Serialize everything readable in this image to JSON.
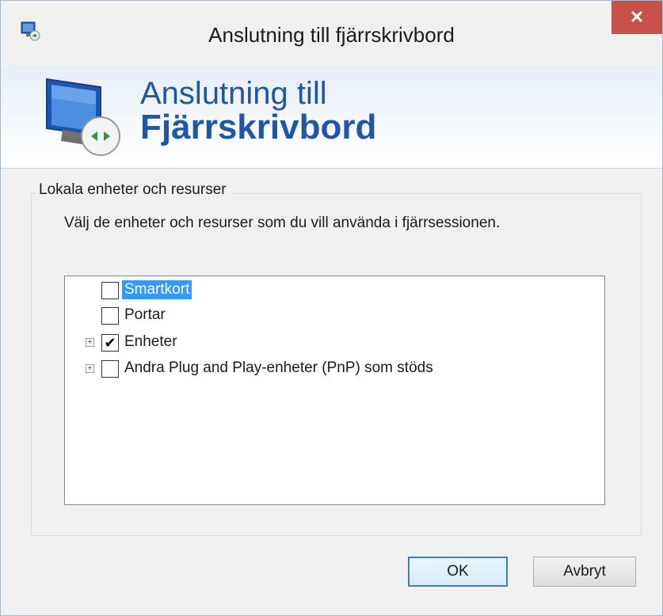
{
  "window": {
    "title": "Anslutning till fjärrskrivbord",
    "close_label": "✕"
  },
  "banner": {
    "line1": "Anslutning till",
    "line2": "Fjärrskrivbord"
  },
  "group": {
    "legend": "Lokala enheter och resurser",
    "description": "Välj de enheter och resurser som du vill använda i fjärrsessionen."
  },
  "tree": {
    "items": [
      {
        "label": "Smartkort",
        "checked": false,
        "selected": true,
        "expandable": false,
        "check_glyph": ""
      },
      {
        "label": "Portar",
        "checked": false,
        "selected": false,
        "expandable": false,
        "check_glyph": ""
      },
      {
        "label": "Enheter",
        "checked": true,
        "selected": false,
        "expandable": true,
        "check_glyph": "✔"
      },
      {
        "label": "Andra Plug and Play-enheter (PnP) som stöds",
        "checked": false,
        "selected": false,
        "expandable": true,
        "check_glyph": ""
      }
    ],
    "expander_glyph": "+"
  },
  "buttons": {
    "ok_label": "OK",
    "cancel_label": "Avbryt"
  },
  "colors": {
    "selection": "#3399ff",
    "banner_text": "#1f56a8",
    "close_button": "#c7504a"
  }
}
